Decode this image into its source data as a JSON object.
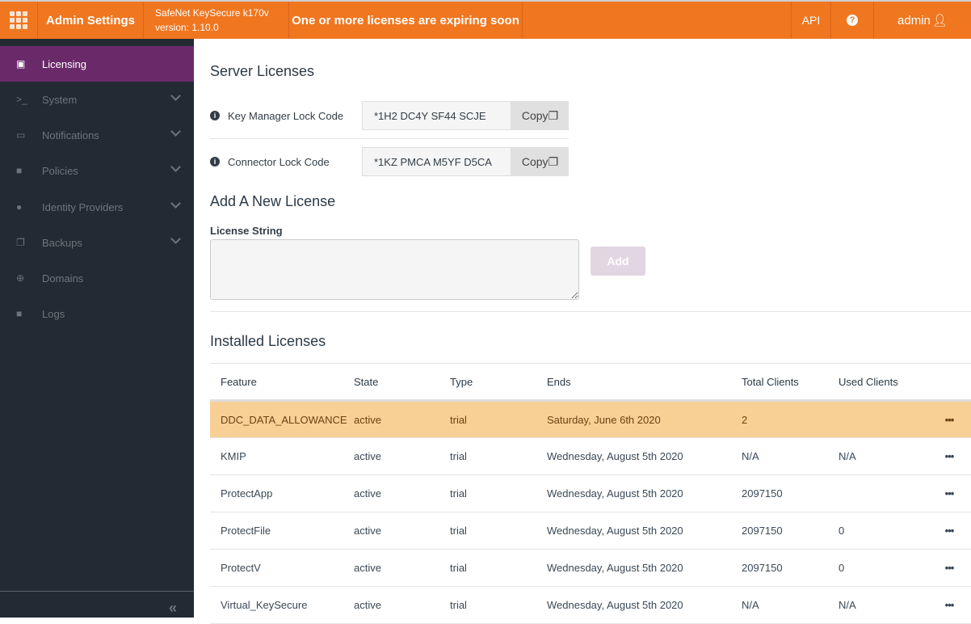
{
  "header": {
    "title": "Admin Settings",
    "product": "SafeNet KeySecure k170v",
    "version": "version: 1.10.0",
    "alert": "One or more licenses are expiring soon",
    "api": "API",
    "help": "?",
    "user": "admin"
  },
  "sidebar": {
    "items": [
      {
        "label": "Licensing",
        "icon": "id-card-icon"
      },
      {
        "label": "System",
        "icon": "terminal-icon"
      },
      {
        "label": "Notifications",
        "icon": "comment-icon"
      },
      {
        "label": "Policies",
        "icon": "lock-icon"
      },
      {
        "label": "Identity Providers",
        "icon": "user-circle-icon"
      },
      {
        "label": "Backups",
        "icon": "copy-icon"
      },
      {
        "label": "Domains",
        "icon": "globe-icon"
      },
      {
        "label": "Logs",
        "icon": "note-icon"
      }
    ],
    "collapse": "«"
  },
  "server": {
    "title": "Server Licenses",
    "copy": "Copy",
    "key_manager": {
      "label": "Key Manager Lock Code",
      "value": "*1H2 DC4Y SF44 SCJE"
    },
    "connector": {
      "label": "Connector Lock Code",
      "value": "*1KZ PMCA M5YF D5CA"
    }
  },
  "add": {
    "title": "Add A New License",
    "label": "License String",
    "value": "",
    "button": "Add"
  },
  "installed": {
    "title": "Installed Licenses",
    "columns": [
      "Feature",
      "State",
      "Type",
      "Ends",
      "Total Clients",
      "Used Clients"
    ],
    "rows": [
      [
        "DDC_DATA_ALLOWANCE",
        "active",
        "trial",
        "Saturday, June 6th 2020",
        "2",
        ""
      ],
      [
        "KMIP",
        "active",
        "trial",
        "Wednesday, August 5th 2020",
        "N/A",
        "N/A"
      ],
      [
        "ProtectApp",
        "active",
        "trial",
        "Wednesday, August 5th 2020",
        "2097150",
        ""
      ],
      [
        "ProtectFile",
        "active",
        "trial",
        "Wednesday, August 5th 2020",
        "2097150",
        "0"
      ],
      [
        "ProtectV",
        "active",
        "trial",
        "Wednesday, August 5th 2020",
        "2097150",
        "0"
      ],
      [
        "Virtual_KeySecure",
        "active",
        "trial",
        "Wednesday, August 5th 2020",
        "N/A",
        "N/A"
      ]
    ],
    "row_menu": "•••"
  }
}
